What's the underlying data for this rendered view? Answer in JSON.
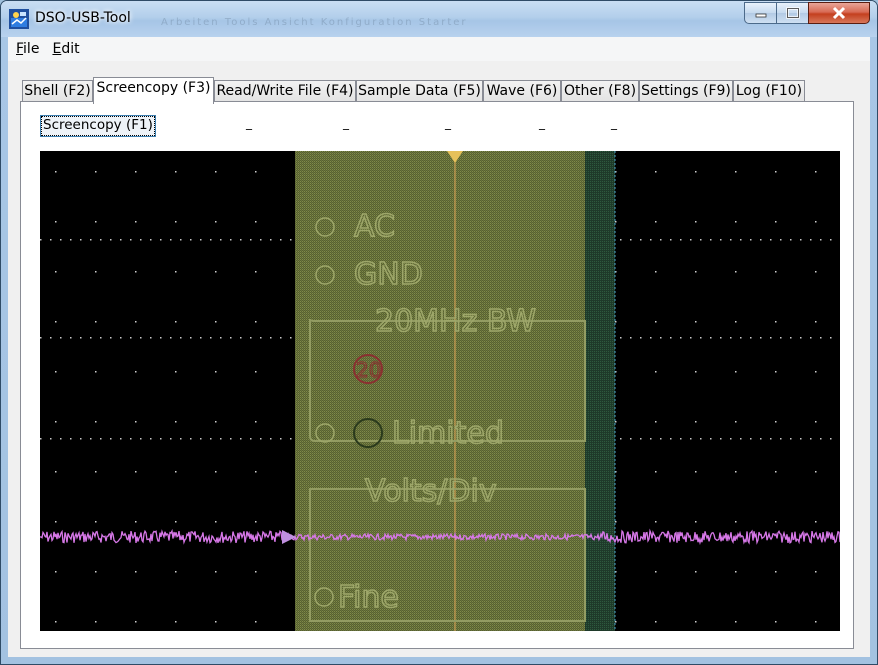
{
  "window": {
    "title": "DSO-USB-Tool",
    "background_titles": "Arbeiten   Tools   Ansicht   Konfiguration   Starter"
  },
  "menu": {
    "items": [
      {
        "label": "File",
        "mnemonic": "F",
        "rest": "ile"
      },
      {
        "label": "Edit",
        "mnemonic": "E",
        "rest": "dit"
      }
    ]
  },
  "tabs": [
    {
      "label": "Shell (F2)",
      "active": false
    },
    {
      "label": "Screencopy (F3)",
      "active": true
    },
    {
      "label": "Read/Write File (F4)",
      "active": false
    },
    {
      "label": "Sample Data (F5)",
      "active": false
    },
    {
      "label": "Wave (F6)",
      "active": false
    },
    {
      "label": "Other (F8)",
      "active": false
    },
    {
      "label": "Settings (F9)",
      "active": false
    },
    {
      "label": "Log (F10)",
      "active": false
    }
  ],
  "screencopy": {
    "button_label": "Screencopy (F1)",
    "placeholders": [
      "_",
      "_",
      "_",
      "_",
      "_"
    ]
  },
  "scope_menu": {
    "items": [
      "AC",
      "GND",
      "20MHz BW",
      "20",
      "Limited",
      "Volts/Div",
      "Fine"
    ]
  },
  "colors": {
    "trace": "#d778e8",
    "overlay": "#6f7a3f",
    "cursor_line": "#e2a657",
    "accent_focus": "#3c7fb1"
  }
}
